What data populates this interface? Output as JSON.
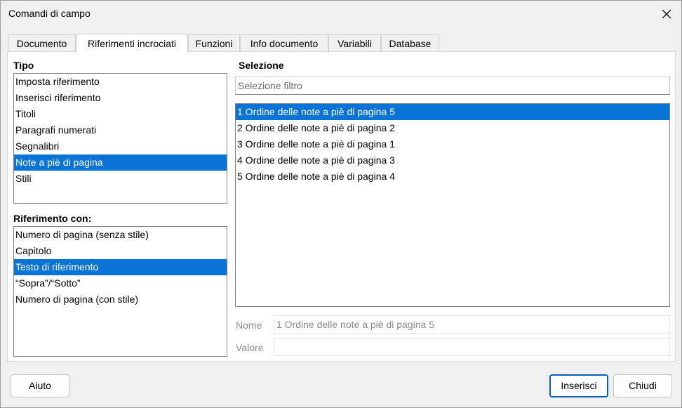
{
  "window": {
    "title": "Comandi di campo"
  },
  "tabs": [
    {
      "label": "Documento",
      "active": false
    },
    {
      "label": "Riferimenti incrociati",
      "active": true
    },
    {
      "label": "Funzioni",
      "active": false
    },
    {
      "label": "Info documento",
      "active": false
    },
    {
      "label": "Variabili",
      "active": false
    },
    {
      "label": "Database",
      "active": false
    }
  ],
  "tipo": {
    "label": "Tipo",
    "items": [
      "Imposta riferimento",
      "Inserisci riferimento",
      "Titoli",
      "Paragrafi numerati",
      "Segnalibri",
      "Note a piè di pagina",
      "Stili"
    ],
    "selected": "Note a piè di pagina"
  },
  "riferimento": {
    "label": "Riferimento con:",
    "items": [
      "Numero di pagina (senza stile)",
      "Capitolo",
      "Testo di riferimento",
      "“Sopra”/“Sotto”",
      "Numero di pagina (con stile)"
    ],
    "selected": "Testo di riferimento"
  },
  "selezione": {
    "label": "Selezione",
    "filter_placeholder": "Selezione filtro",
    "items": [
      "1 Ordine delle note a piè di pagina 5",
      "2 Ordine delle note a piè di pagina 2",
      "3 Ordine delle note a piè di pagina 1",
      "4 Ordine delle note a piè di pagina 3",
      "5 Ordine delle note a piè di pagina 4"
    ],
    "selected": "1 Ordine delle note a piè di pagina 5"
  },
  "nome": {
    "label": "Nome",
    "value": "1 Ordine delle note a piè di pagina 5"
  },
  "valore": {
    "label": "Valore",
    "value": ""
  },
  "buttons": {
    "help": "Aiuto",
    "insert": "Inserisci",
    "close": "Chiudi"
  },
  "colors": {
    "selection": "#0a74d6",
    "default_button_border": "#0a5fb4"
  }
}
